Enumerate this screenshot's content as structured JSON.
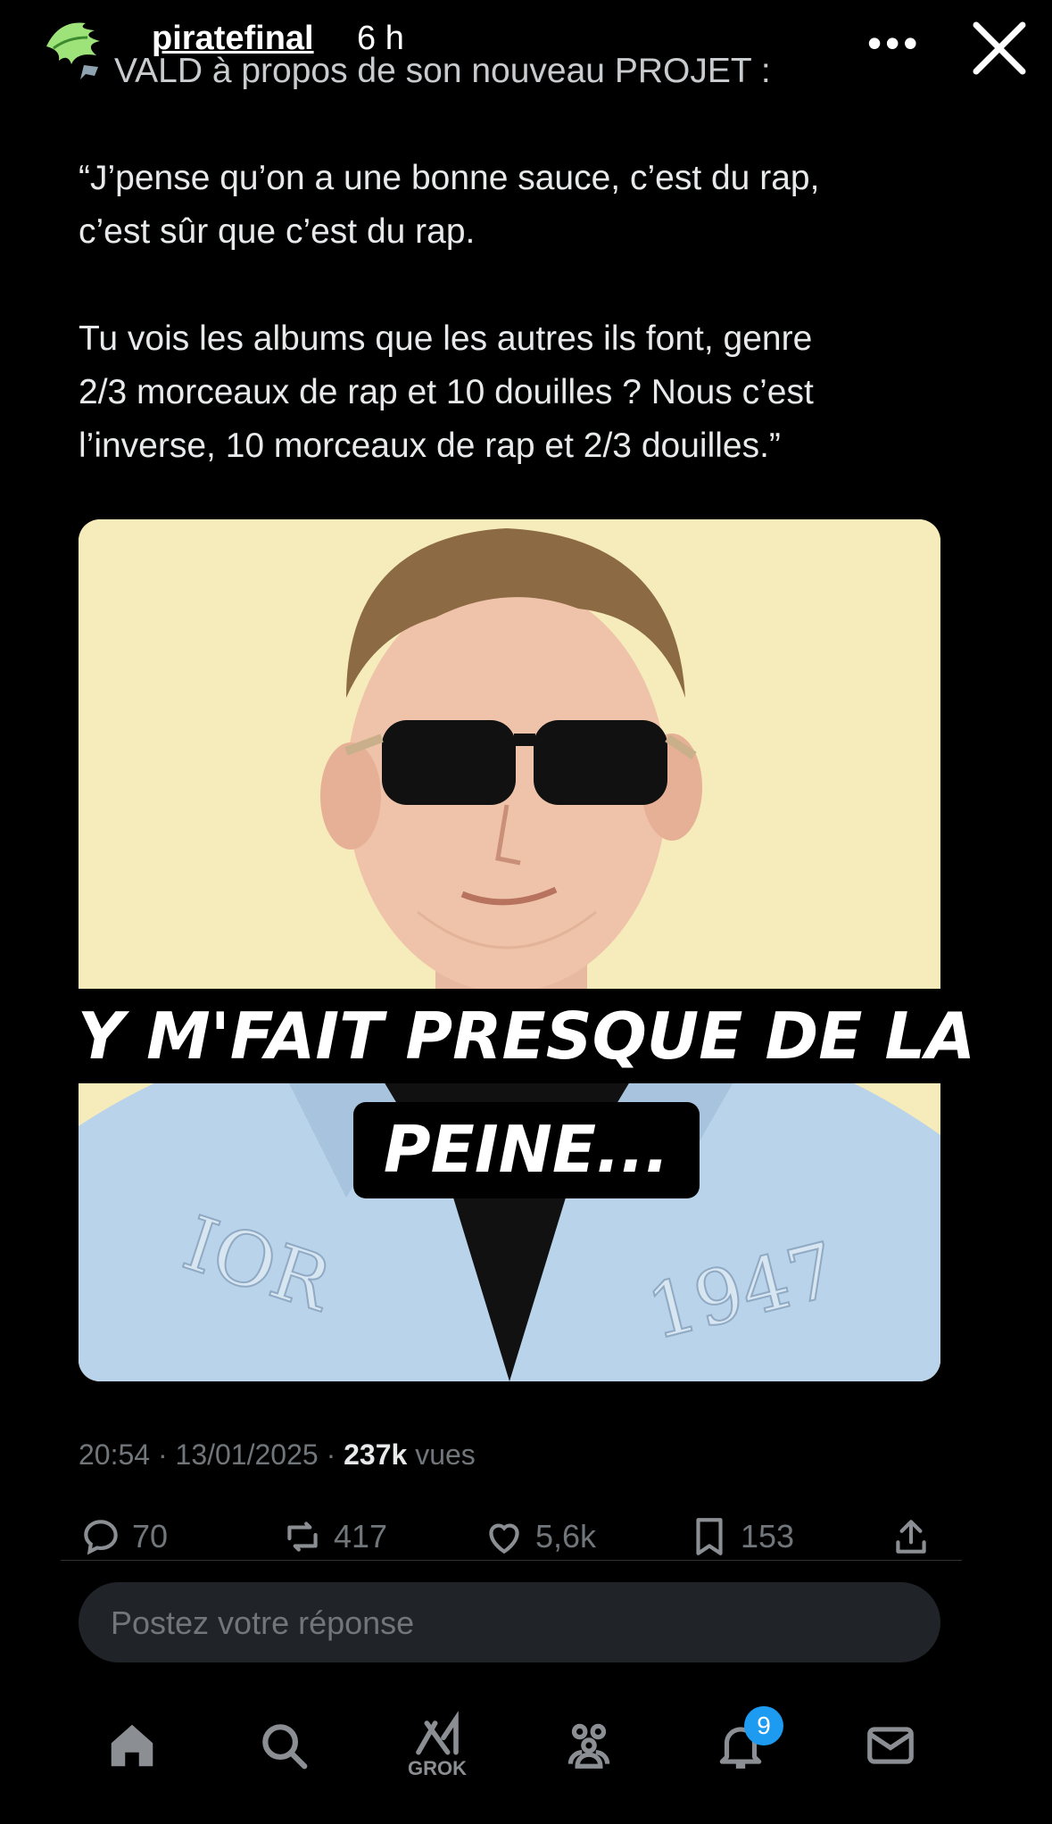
{
  "story": {
    "username": "piratefinal",
    "time": "6 h",
    "more_label": "•••"
  },
  "tweet": {
    "line1": "VALD à propos de son nouveau PROJET :",
    "para1_line1": "“J’pense qu’on a une bonne sauce, c’est du rap,",
    "para1_line2": "c’est sûr que c’est du rap.",
    "para2_line1": "Tu vois les albums que les autres ils font, genre",
    "para2_line2": "2/3 morceaux de rap et 10 douilles ? Nous c’est",
    "para2_line3": "l’inverse, 10 morceaux de rap et 2/3 douilles.”",
    "caption_line1": "Y M'FAIT PRESQUE DE LA",
    "caption_line2": "PEINE...",
    "jacket_left": "IOR",
    "jacket_right": "1947",
    "timestamp": "20:54 · 13/01/2025 ·",
    "views_count": "237k",
    "views_label": "vues"
  },
  "actions": {
    "replies": "70",
    "reposts": "417",
    "likes": "5,6k",
    "bookmarks": "153"
  },
  "reply": {
    "placeholder": "Postez votre réponse"
  },
  "nav": {
    "grok_label": "GROK",
    "notifications_badge": "9"
  },
  "colors": {
    "background": "#000000",
    "text": "#e7e9ea",
    "muted": "#71767b",
    "accent": "#1d9bf0",
    "photo_bg": "#f6ebba",
    "jacket": "#b9d3ea"
  }
}
